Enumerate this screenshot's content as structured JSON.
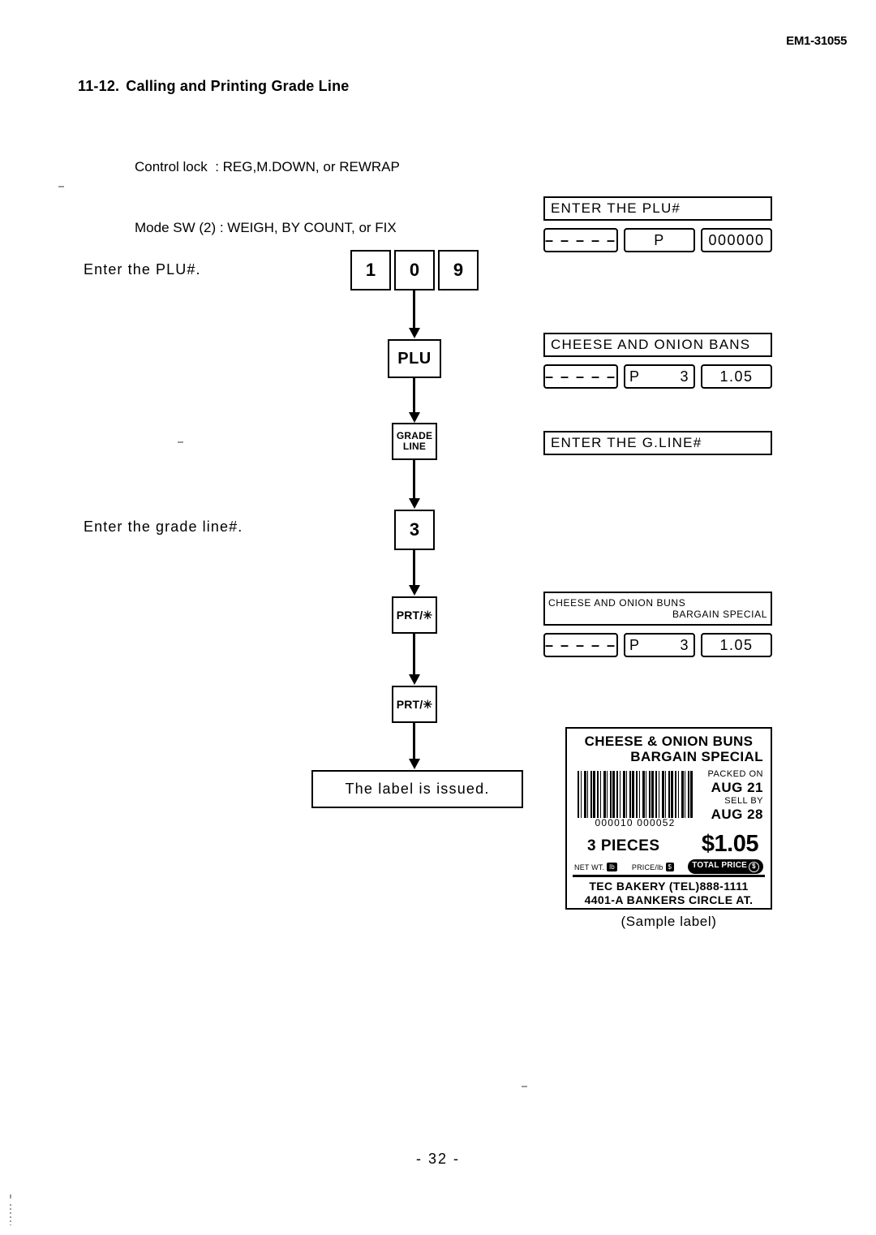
{
  "document": {
    "code": "EM1-31055",
    "page_number": "- 32 -"
  },
  "section": {
    "number": "11-12.",
    "title": "Calling and Printing Grade Line"
  },
  "settings": {
    "line1": "Control lock  : REG,M.DOWN, or REWRAP",
    "line2": "Mode SW (2) : WEIGH, BY COUNT, or FIX"
  },
  "steps": [
    {
      "caption": "Enter the PLU#."
    },
    {
      "caption": "Enter the grade line#."
    }
  ],
  "flow": {
    "keys": {
      "one": "1",
      "zero": "0",
      "nine": "9",
      "plu": "PLU",
      "grade_line_l1": "GRADE",
      "grade_line_l2": "LINE",
      "three": "3",
      "print_1": "PRT/✳",
      "print_2": "PRT/✳"
    },
    "result_box": "The label is issued."
  },
  "displays": [
    {
      "id": "enter-plu",
      "message": "ENTER THE PLU#",
      "dashes": "– – – – –",
      "middle": "P",
      "middle_right": "",
      "right": "000000"
    },
    {
      "id": "plu-called",
      "message": "CHEESE AND ONION BANS",
      "dashes": "– – – – –",
      "middle": "P",
      "middle_right": "3",
      "right": "1.05"
    },
    {
      "id": "enter-grade-line",
      "message": "ENTER THE G.LINE#"
    },
    {
      "id": "grade-line-called",
      "message_row1": "CHEESE AND ONION BUNS",
      "message_row2": "BARGAIN SPECIAL",
      "dashes": "– – – – –",
      "middle": "P",
      "middle_right": "3",
      "right": "1.05"
    }
  ],
  "sample_label": {
    "caption": "(Sample label)",
    "title": "CHEESE & ONION BUNS",
    "subtitle": "BARGAIN SPECIAL",
    "barcode_digits": "000010  000052",
    "packed_on_label": "PACKED ON",
    "packed_on_date": "AUG 21",
    "sell_by_label": "SELL BY",
    "sell_by_date": "AUG 28",
    "quantity": "3 PIECES",
    "price": "$1.05",
    "net_wt_label": "NET WT.",
    "net_wt_chip": "lb",
    "price_per_label": "PRICE/lb",
    "price_per_chip": "$",
    "total_price_label": "TOTAL PRICE",
    "total_price_chip": "$",
    "store_line1": "TEC BAKERY (TEL)888-1111",
    "store_line2": "4401-A BANKERS CIRCLE AT."
  }
}
